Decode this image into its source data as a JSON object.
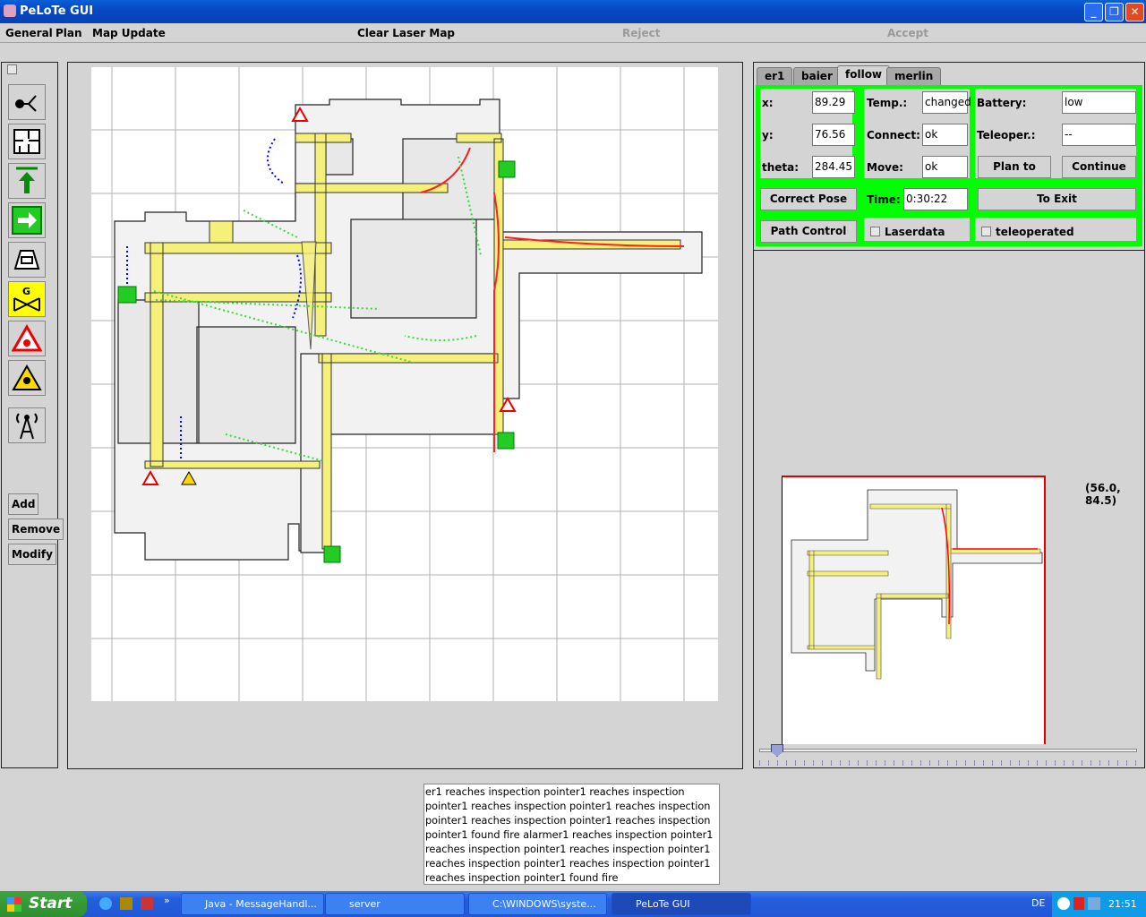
{
  "window": {
    "title": "PeLoTe GUI"
  },
  "menu": {
    "general": "General",
    "plan": "Plan",
    "map_update": "Map Update",
    "clear_laser_map": "Clear Laser Map",
    "reject": "Reject",
    "accept": "Accept"
  },
  "toolbar": {
    "add": "Add",
    "remove": "Remove",
    "modify": "Modify",
    "icons": [
      "person-icon",
      "floorplan-icon",
      "arrow-up-exit-icon",
      "arrow-right-exit-icon",
      "camera-icon",
      "gas-valve-icon",
      "fire-warning-icon",
      "toxic-warning-icon",
      "radio-tower-icon"
    ]
  },
  "tabs": [
    {
      "label": "er1"
    },
    {
      "label": "baier"
    },
    {
      "label": "follow"
    },
    {
      "label": "merlin"
    }
  ],
  "status": {
    "x_label": "x:",
    "x": "89.29",
    "y_label": "y:",
    "y": "76.56",
    "theta_label": "theta:",
    "theta": "284.45",
    "temp_label": "Temp.:",
    "temp": "changed",
    "connect_label": "Connect:",
    "connect": "ok",
    "move_label": "Move:",
    "move": "ok",
    "battery_label": "Battery:",
    "battery": "low",
    "teleop_label": "Teleoper.:",
    "teleop": "--",
    "plan_to": "Plan to",
    "continue": "Continue",
    "correct_pose": "Correct Pose",
    "time_label": "Time:",
    "time": "0:30:22",
    "to_exit": "To Exit",
    "path_control": "Path Control",
    "laserdata": "Laserdata",
    "teleoperated": "teleoperated"
  },
  "coords": "(56.0, 84.5)",
  "colors": {
    "status_border": "#00ff00",
    "corridor": "#f5f07a",
    "path_red": "#ff0000",
    "trace_green": "#22dd22",
    "trace_blue": "#0000ff"
  },
  "log": "er1 reaches inspection pointer1 reaches inspection pointer1 reaches inspection pointer1 reaches inspection pointer1 reaches inspection pointer1 reaches inspection pointer1 found fire alarmer1 reaches inspection pointer1 reaches inspection pointer1 reaches inspection pointer1 reaches inspection pointer1 reaches inspection pointer1 reaches inspection pointer1 found fire",
  "taskbar": {
    "start": "Start",
    "tasks": [
      "Java - MessageHandl...",
      "server",
      "C:\\WINDOWS\\syste...",
      "PeLoTe GUI"
    ],
    "lang": "DE",
    "clock": "21:51"
  }
}
